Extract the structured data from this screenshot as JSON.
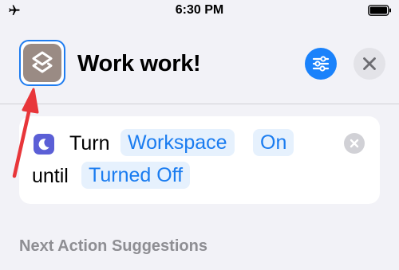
{
  "status_bar": {
    "time": "6:30 PM",
    "left_icon": "airplane-icon",
    "right_icon": "battery-icon"
  },
  "header": {
    "title": "Work work!",
    "app_icon": "layers-icon",
    "app_icon_color": "#9a8b84",
    "settings_icon": "sliders-icon",
    "close_icon": "close-icon"
  },
  "action": {
    "icon": "moon-icon",
    "icon_color": "#5b5fd6",
    "verb": "Turn",
    "focus_mode": "Workspace",
    "state": "On",
    "connector": "until",
    "until_condition": "Turned Off",
    "remove_icon": "clear-icon"
  },
  "suggestions": {
    "title": "Next Action Suggestions"
  },
  "annotation": {
    "arrow_color": "#e8363a"
  },
  "colors": {
    "accent": "#1a82fb",
    "background": "#f2f2f7",
    "token_bg": "#e6f1fd"
  }
}
